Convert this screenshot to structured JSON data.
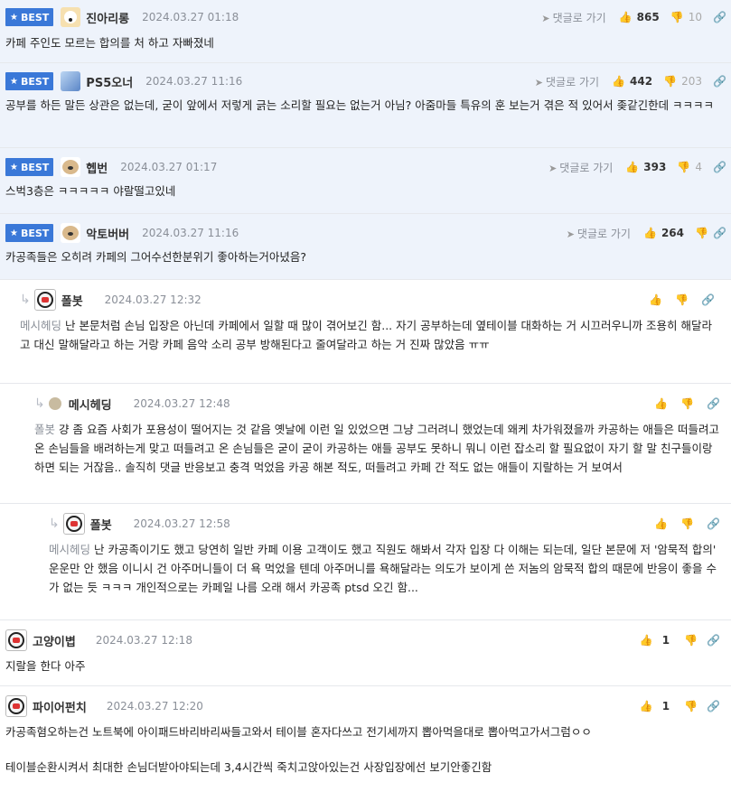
{
  "best_label": "BEST",
  "goto_label": "댓글로 가기",
  "best_comments": [
    {
      "nick": "진아리롱",
      "date": "2024.03.27 01:18",
      "up": "865",
      "down": "10",
      "body": "카페 주인도 모르는 합의를 처 하고 자빠졌네"
    },
    {
      "nick": "PS5오너",
      "date": "2024.03.27 11:16",
      "up": "442",
      "down": "203",
      "body": "공부를 하든 말든 상관은 없는데, 굳이 앞에서 저렇게 긁는 소리할 필요는 없는거 아님? 아줌마들 특유의 훈 보는거 겪은 적 있어서 좆같긴한데 ㅋㅋㅋㅋ"
    },
    {
      "nick": "헵번",
      "date": "2024.03.27 01:17",
      "up": "393",
      "down": "4",
      "body": "스벅3층은 ㅋㅋㅋㅋㅋ 야랄떨고있네"
    },
    {
      "nick": "악토버버",
      "date": "2024.03.27 11:16",
      "up": "264",
      "down": "",
      "body": "카공족들은 오히려 카페의 그어수선한분위기 좋아하는거아녔음?"
    }
  ],
  "replies": [
    {
      "nick": "폴봇",
      "date": "2024.03.27 12:32",
      "mention": "메시헤딩",
      "text": "난 본문처럼 손님 입장은 아닌데 카페에서 일할 때 많이 겪어보긴 함... 자기 공부하는데 옆테이블 대화하는 거 시끄러우니까 조용히 해달라고 대신 말해달라고 하는 거랑 카페 음악 소리 공부 방해된다고 줄여달라고 하는 거 진짜 많았음 ㅠㅠ"
    },
    {
      "nick": "메시헤딩",
      "date": "2024.03.27 12:48",
      "mention": "폴봇",
      "text": "걍 좀 요즘 사회가 포용성이 떨어지는 것 같음 옛날에 이런 일 있었으면 그냥 그러려니 했었는데 왜케 차가워졌을까 카공하는 애들은 떠들려고 온 손님들을 배려하는게 맞고 떠들려고 온 손님들은 굳이 굳이 카공하는 애들 공부도 못하니 뭐니 이런 잡소리 할 필요없이 자기 할 말 친구들이랑 하면 되는 거잖음.. 솔직히 댓글 반응보고 충격 먹었음 카공 해본 적도, 떠들려고 카페 간 적도 없는 애들이 지랄하는 거 보여서"
    },
    {
      "nick": "폴봇",
      "date": "2024.03.27 12:58",
      "mention": "메시헤딩",
      "text": "난 카공족이기도 했고 당연히 일반 카페 이용 고객이도 했고 직원도 해봐서 각자 입장 다 이해는 되는데, 일단 본문에 저 '암묵적 합의' 운운만 안 했음 이니시 건 아주머니들이 더 욕 먹었을 텐데 아주머니를 욕해달라는 의도가 보이게 쓴 저놈의 암묵적 합의 때문에 반응이 좋을 수가 없는 듯 ㅋㅋㅋ 개인적으로는 카페일 나름 오래 해서 카공족 ptsd 오긴 함..."
    }
  ],
  "normal_comments": [
    {
      "nick": "고양이볍",
      "date": "2024.03.27 12:18",
      "up": "1",
      "body": "지랄을 한다 아주"
    },
    {
      "nick": "파이어펀치",
      "date": "2024.03.27 12:20",
      "up": "1",
      "body": "카공족혐오하는건 노트북에 아이패드바리바리싸들고와서 테이블 혼자다쓰고 전기세까지 뽑아먹을대로 뽑아먹고가서그럼ㅇㅇ",
      "body2": "테이블순환시켜서 최대한 손님더받아야되는데 3,4시간씩 죽치고앉아있는건 사장입장에선 보기안좋긴함"
    }
  ]
}
